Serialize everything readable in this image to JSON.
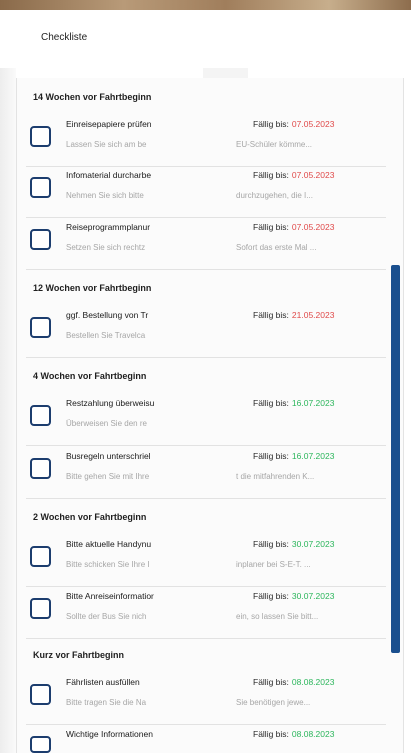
{
  "header": {
    "title": "Checkliste"
  },
  "colors": {
    "overdue": "#e04a4a",
    "upcoming": "#2cb65c",
    "scrollbar": "#1a4f8e"
  },
  "sections": [
    {
      "title": "14 Wochen vor Fahrtbeginn",
      "tasks": [
        {
          "title": "Einreisepapiere prüfen",
          "desc": "Lassen Sie sich am be",
          "desc2": "EU-Schüler kömme...",
          "due_label": "Fällig bis:",
          "date": "07.05.2023",
          "status": "overdue"
        },
        {
          "title": "Infomaterial durcharbe",
          "desc": "Nehmen Sie sich bitte",
          "desc2": "durchzugehen, die I...",
          "due_label": "Fällig bis:",
          "date": "07.05.2023",
          "status": "overdue"
        },
        {
          "title": "Reiseprogrammplanur",
          "desc": "Setzen Sie sich rechtz",
          "desc2": "Sofort das erste Mal ...",
          "due_label": "Fällig bis:",
          "date": "07.05.2023",
          "status": "overdue"
        }
      ]
    },
    {
      "title": "12 Wochen vor Fahrtbeginn",
      "tasks": [
        {
          "title": "ggf. Bestellung von Tr",
          "desc": "Bestellen Sie Travelca",
          "desc2": "",
          "due_label": "Fällig bis:",
          "date": "21.05.2023",
          "status": "overdue"
        }
      ]
    },
    {
      "title": "4 Wochen vor Fahrtbeginn",
      "tasks": [
        {
          "title": "Restzahlung überweisu",
          "desc": "Überweisen Sie den re",
          "desc2": "",
          "due_label": "Fällig bis:",
          "date": "16.07.2023",
          "status": "upcoming"
        },
        {
          "title": "Busregeln unterschriel",
          "desc": "Bitte gehen Sie mit Ihre",
          "desc2": "t die mitfahrenden K...",
          "due_label": "Fällig bis:",
          "date": "16.07.2023",
          "status": "upcoming"
        }
      ]
    },
    {
      "title": "2 Wochen vor Fahrtbeginn",
      "tasks": [
        {
          "title": "Bitte aktuelle Handynu",
          "desc": "Bitte schicken Sie Ihre I",
          "desc2": "inplaner bei S-E-T. ...",
          "due_label": "Fällig bis:",
          "date": "30.07.2023",
          "status": "upcoming"
        },
        {
          "title": "Bitte Anreiseinformatior",
          "desc": "Sollte der Bus Sie nich",
          "desc2": "ein, so lassen Sie bitt...",
          "due_label": "Fällig bis:",
          "date": "30.07.2023",
          "status": "upcoming"
        }
      ]
    },
    {
      "title": "Kurz vor Fahrtbeginn",
      "tasks": [
        {
          "title": "Fährlisten ausfüllen",
          "desc": "Bitte tragen Sie die Na",
          "desc2": "Sie benötigen jewe...",
          "due_label": "Fällig bis:",
          "date": "08.08.2023",
          "status": "upcoming"
        },
        {
          "title": "Wichtige Informationen",
          "desc": "",
          "desc2": "",
          "due_label": "Fällig bis:",
          "date": "08.08.2023",
          "status": "upcoming"
        }
      ]
    }
  ]
}
